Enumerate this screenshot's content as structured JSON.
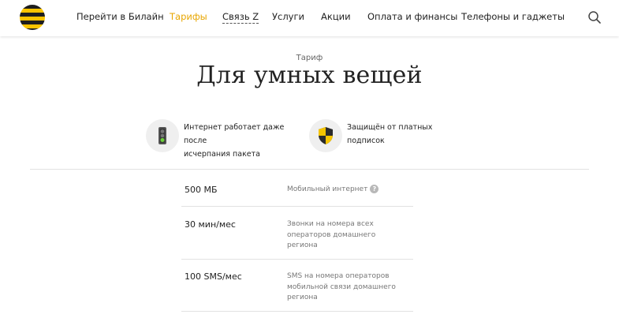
{
  "header": {
    "nav": [
      {
        "label": "Перейти в Билайн"
      },
      {
        "label": "Тарифы"
      },
      {
        "label": "Связь Z"
      },
      {
        "label": "Услуги"
      },
      {
        "label": "Акции"
      },
      {
        "label": "Оплата и финансы"
      },
      {
        "label": "Телефоны и гаджеты"
      }
    ],
    "active_color": "#e8a600"
  },
  "tariff": {
    "label": "Тариф",
    "title": "Для умных вещей"
  },
  "features": [
    {
      "icon": "traffic-light-icon",
      "line1": "Интернет работает даже после",
      "line2": "исчерпания пакета"
    },
    {
      "icon": "shield-icon",
      "line1": "Защищён от платных подписок"
    }
  ],
  "params": [
    {
      "value": "500 МБ",
      "desc": "Мобильный интернет",
      "help": "?"
    },
    {
      "value": "30 мин/мес",
      "desc_lines": [
        "Звонки на номера всех",
        "операторов домашнего",
        "региона"
      ]
    },
    {
      "value": "100 SMS/мес",
      "desc_lines": [
        "SMS на номера операторов",
        "мобильной связи домашнего",
        "региона"
      ]
    }
  ],
  "brand_colors": {
    "yellow": "#fbc300",
    "black": "#1e1e1e"
  }
}
